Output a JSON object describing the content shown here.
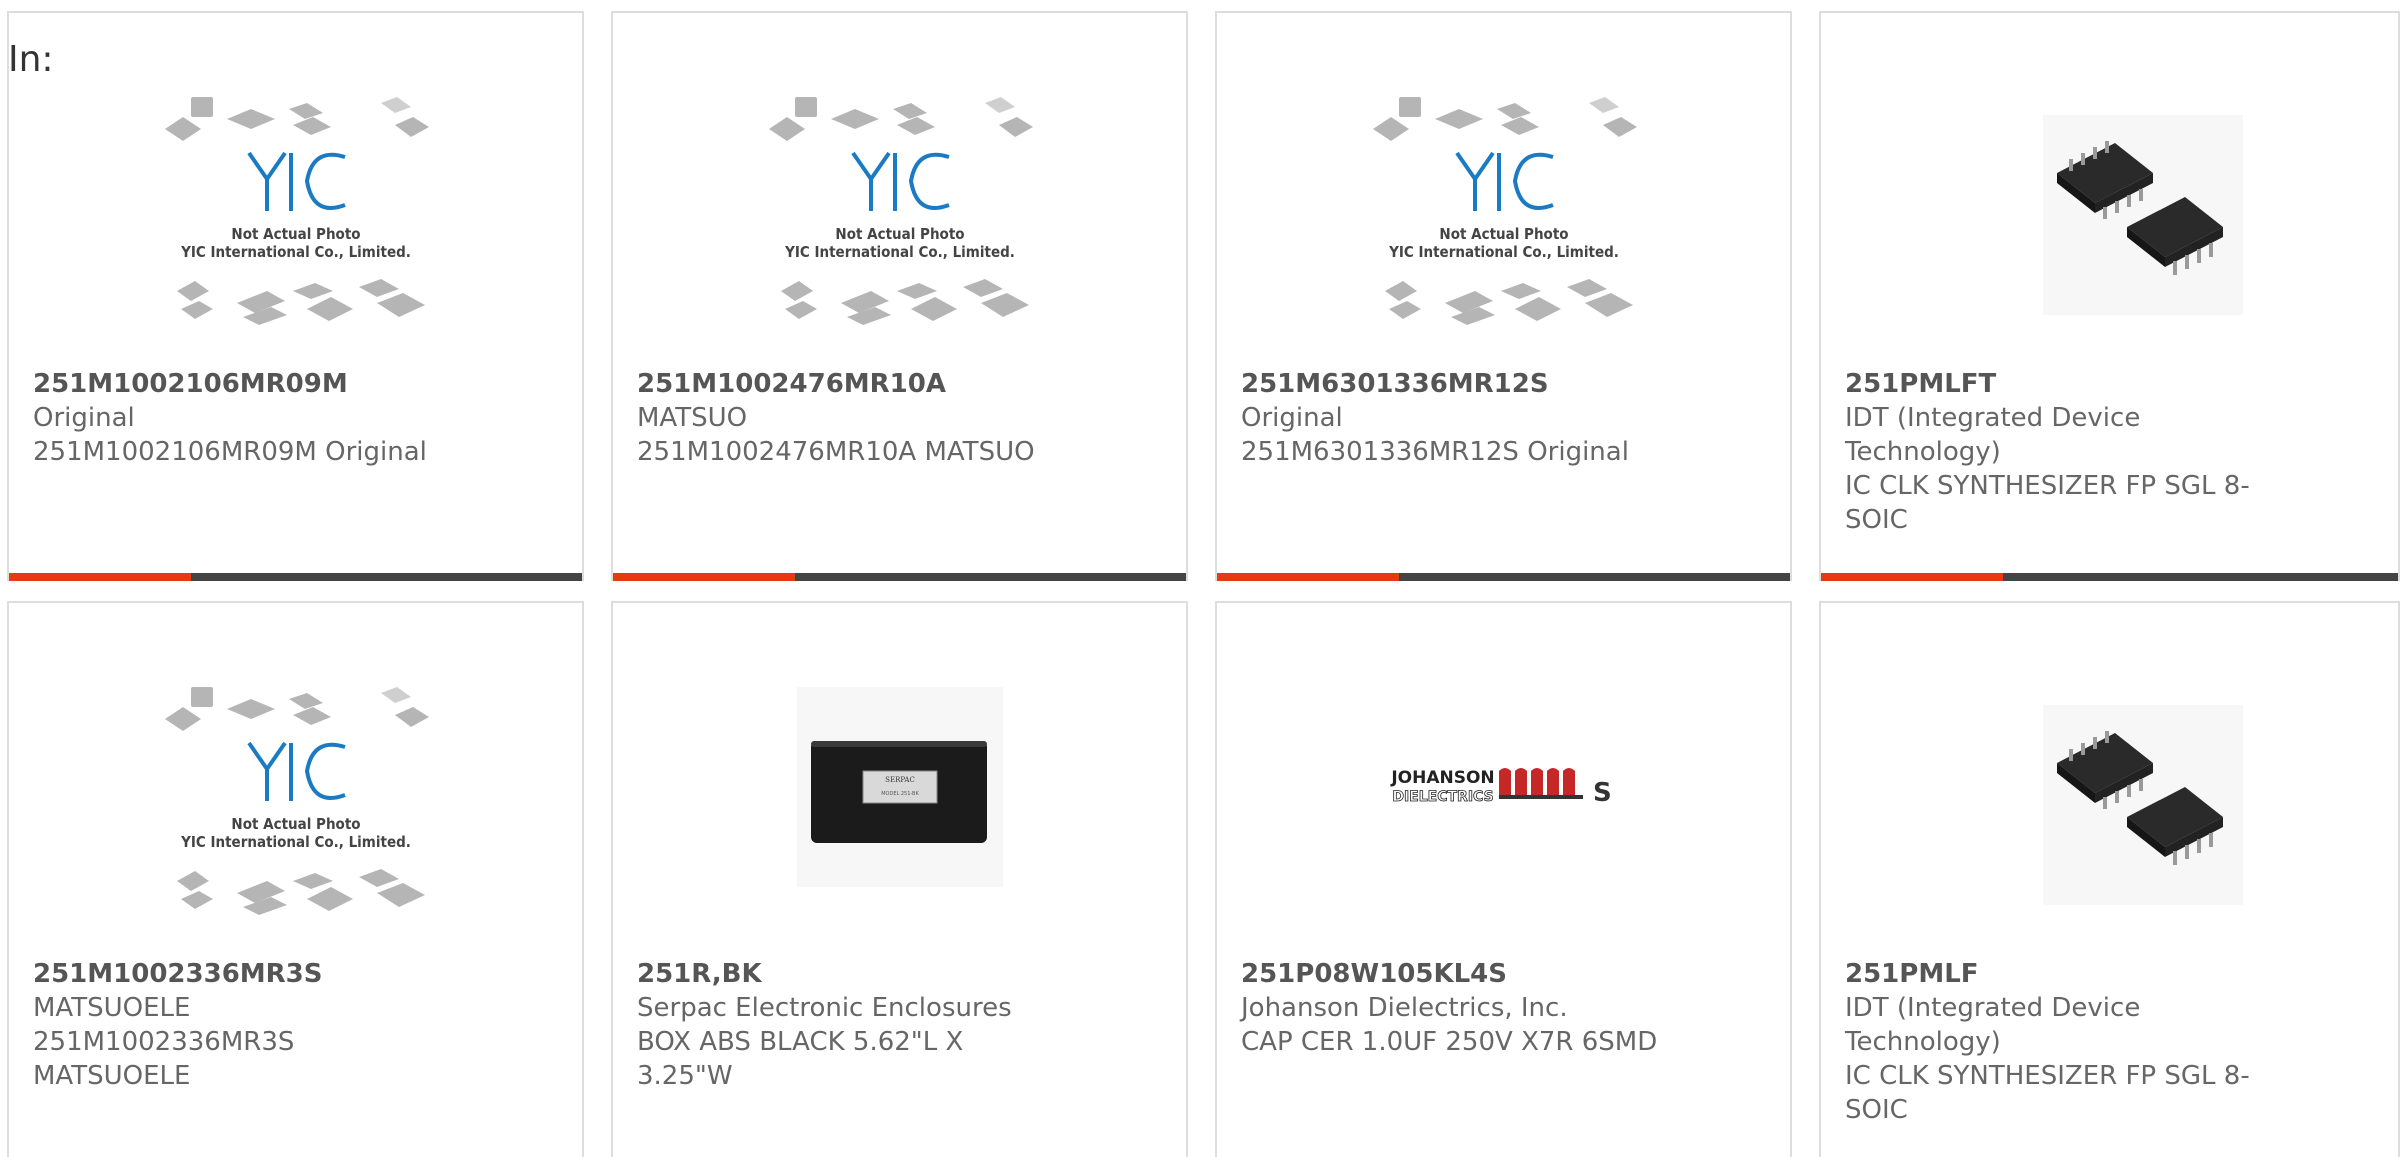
{
  "page": {
    "in_label": "In:"
  },
  "placeholder_image": {
    "line1": "Not Actual Photo",
    "line2": "YIC International Co., Limited."
  },
  "brand_logo": {
    "johanson_line1": "JOHANSON",
    "johanson_line2": "DIELECTRICS"
  },
  "enclosure_label": {
    "line1": "SERPAC",
    "line2": "MODEL 251-BK"
  },
  "products": [
    {
      "part_number": "251M1002106MR09M",
      "manufacturer": "Original",
      "description": "251M1002106MR09M Original",
      "image": "yic-placeholder-photo"
    },
    {
      "part_number": "251M1002476MR10A",
      "manufacturer": "MATSUO",
      "description": "251M1002476MR10A MATSUO",
      "image": "yic-placeholder-photo"
    },
    {
      "part_number": "251M6301336MR12S",
      "manufacturer": "Original",
      "description": "251M6301336MR12S Original",
      "image": "yic-placeholder-photo"
    },
    {
      "part_number": "251PMLFT",
      "manufacturer": "IDT (Integrated Device Technology)",
      "description": "IC CLK SYNTHESIZER FP SGL 8-SOIC",
      "image": "soic-8-chip-photo"
    },
    {
      "part_number": "251M1002336MR3S",
      "manufacturer": "MATSUOELE",
      "description": "251M1002336MR3S MATSUOELE",
      "image": "yic-placeholder-photo"
    },
    {
      "part_number": "251R,BK",
      "manufacturer": "Serpac Electronic Enclosures",
      "description": "BOX ABS BLACK 5.62\"L X 3.25\"W",
      "image": "black-enclosure-box-photo"
    },
    {
      "part_number": "251P08W105KL4S",
      "manufacturer": "Johanson Dielectrics, Inc.",
      "description": "CAP CER 1.0UF 250V X7R 6SMD",
      "image": "johanson-dielectrics-logo"
    },
    {
      "part_number": "251PMLF",
      "manufacturer": "IDT (Integrated Device Technology)",
      "description": "IC CLK SYNTHESIZER FP SGL 8-SOIC",
      "image": "soic-8-chip-photo"
    }
  ],
  "colors": {
    "accent": "#e53a12",
    "bar": "#444444",
    "card_border": "#dddddd",
    "yic_blue": "#1a7bc4"
  }
}
